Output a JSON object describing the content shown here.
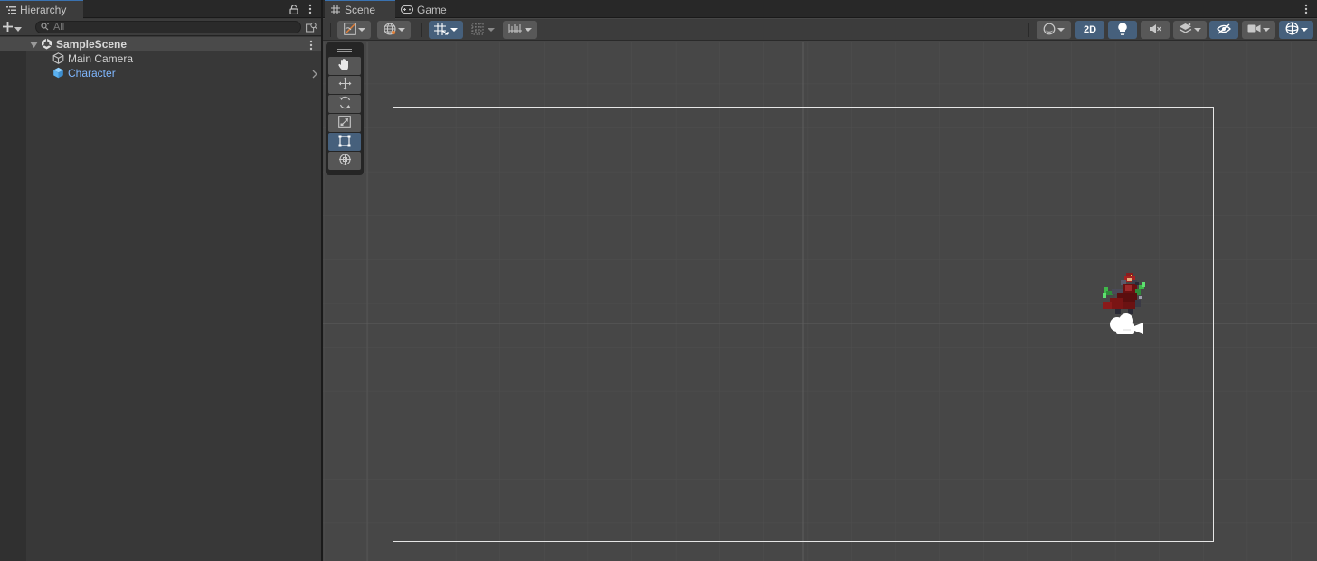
{
  "hierarchy": {
    "tab_label": "Hierarchy",
    "search_placeholder": "All",
    "scene": {
      "name": "SampleScene"
    },
    "items": [
      {
        "label": "Main Camera",
        "icon": "gameobject-icon",
        "selected": false
      },
      {
        "label": "Character",
        "icon": "prefab-icon",
        "selected": true
      }
    ]
  },
  "scene_view": {
    "tabs": [
      {
        "label": "Scene",
        "icon": "scene-grid-icon",
        "active": true
      },
      {
        "label": "Game",
        "icon": "gamepad-icon",
        "active": false
      }
    ],
    "toolbar": {
      "mode_2d_label": "2D",
      "mode_2d_on": true
    },
    "tools": [
      "hand",
      "move",
      "rotate",
      "scale",
      "rect",
      "transform"
    ],
    "active_tool": "rect"
  },
  "colors": {
    "accent": "#46607c",
    "selection_text": "#7fb7ff",
    "prefab_icon": "#5ab1f1",
    "panel_bg": "#383838",
    "viewport_bg": "#474747"
  }
}
